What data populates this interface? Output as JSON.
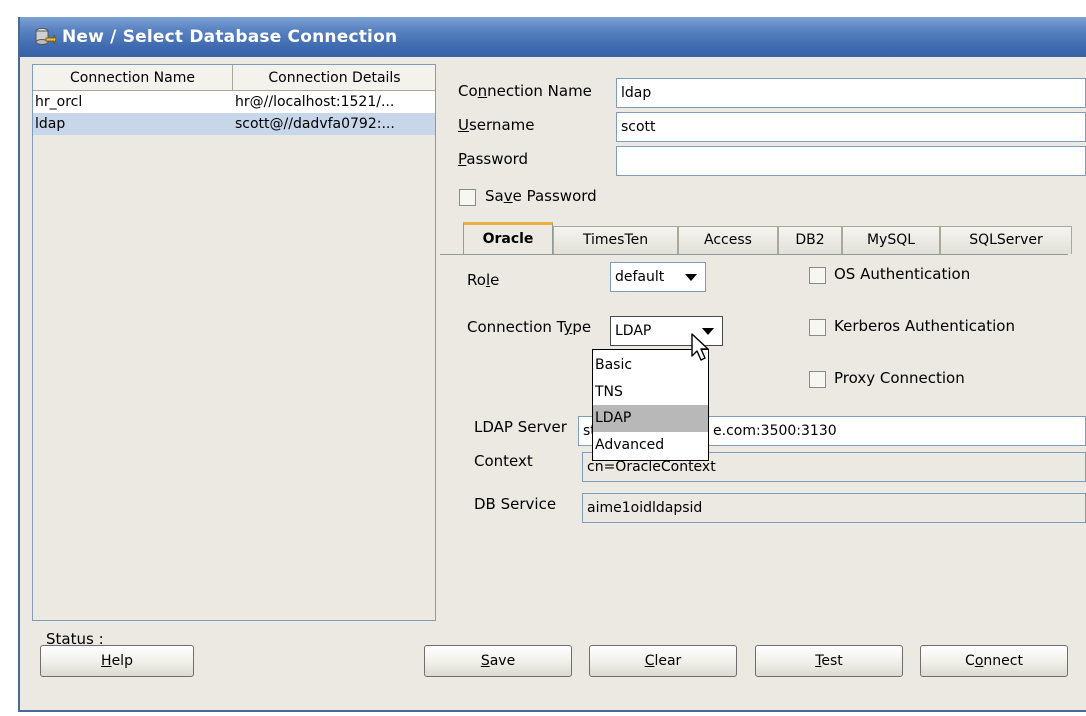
{
  "window": {
    "title": "New / Select Database Connection"
  },
  "connections": {
    "headers": [
      "Connection Name",
      "Connection Details"
    ],
    "rows": [
      {
        "name": "hr_orcl",
        "details": "hr@//localhost:1521/..."
      },
      {
        "name": "ldap",
        "details": "scott@//dadvfa0792:..."
      }
    ],
    "selected_index": 1
  },
  "form": {
    "connection_name_label_pre": "Co",
    "connection_name_label_u": "n",
    "connection_name_label_post": "nection Name",
    "connection_name_value": "ldap",
    "username_label_u": "U",
    "username_label_post": "sername",
    "username_value": "scott",
    "password_label_u": "P",
    "password_label_post": "assword",
    "password_value": "",
    "save_password_pre": "Sa",
    "save_password_u": "v",
    "save_password_post": "e Password"
  },
  "tabs": {
    "items": [
      "Oracle",
      "TimesTen",
      "Access",
      "DB2",
      "MySQL",
      "SQLServer"
    ],
    "active": "Oracle"
  },
  "oracle": {
    "role_label_pre": "Ro",
    "role_label_u": "l",
    "role_label_post": "e",
    "role_value": "default",
    "os_auth_label": "OS Authentication",
    "kerberos_label": "Kerberos Authentication",
    "proxy_label": "Proxy Connection",
    "connection_type_pre": "Connection T",
    "connection_type_u": "y",
    "connection_type_post": "pe",
    "connection_type_value": "LDAP",
    "connection_type_options": [
      "Basic",
      "TNS",
      "LDAP",
      "Advanced"
    ],
    "connection_type_selected": "LDAP",
    "ldap_server_label": "LDAP Server",
    "ldap_server_visible_start": "stb",
    "ldap_server_visible_end": "e.com:3500:3130",
    "context_label": "Context",
    "context_value": "cn=OracleContext",
    "db_service_label": "DB Service",
    "db_service_value": "aime1oidldapsid"
  },
  "status": {
    "label": "Status :"
  },
  "buttons": {
    "help_u": "H",
    "help_post": "elp",
    "save_u": "S",
    "save_post": "ave",
    "clear_u": "C",
    "clear_post": "lear",
    "test_u": "T",
    "test_post": "est",
    "connect_pre": "C",
    "connect_u": "o",
    "connect_post": "nnect"
  },
  "colors": {
    "title_bar": "#3f6ab0",
    "dialog_bg": "#ebe9e2",
    "selected_row": "#c8d6ea",
    "active_tab_accent": "#e9b043"
  }
}
